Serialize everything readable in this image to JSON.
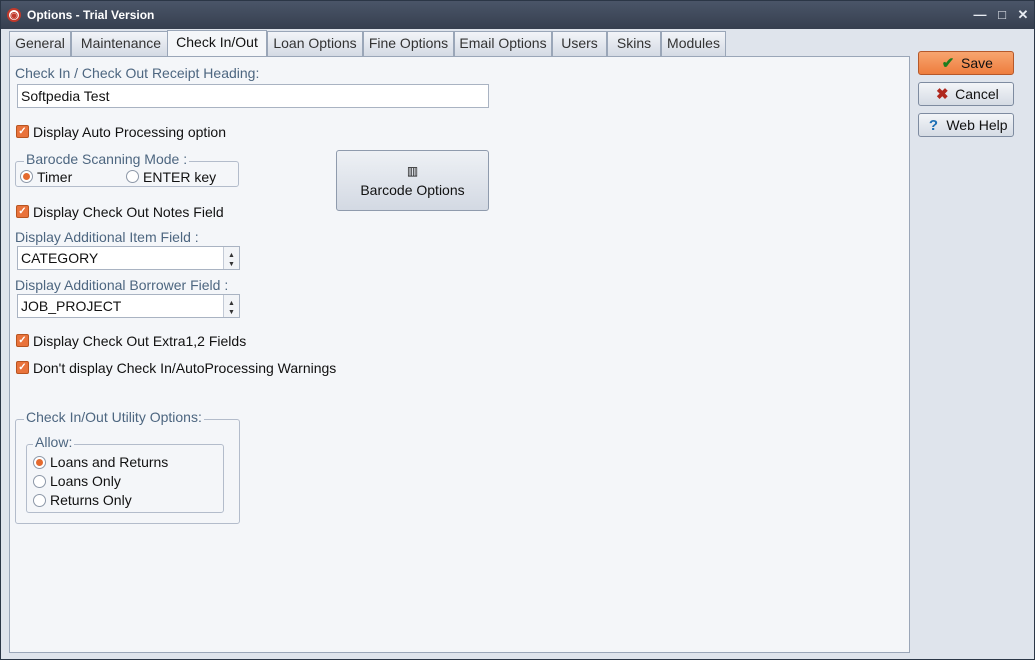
{
  "window": {
    "title": "Options - Trial Version",
    "controls": {
      "minimize": "—",
      "maximize": "□",
      "close": "✕"
    }
  },
  "tabs": [
    {
      "label": "General"
    },
    {
      "label": "Maintenance"
    },
    {
      "label": "Check In/Out",
      "active": true
    },
    {
      "label": "Loan Options"
    },
    {
      "label": "Fine Options"
    },
    {
      "label": "Email Options"
    },
    {
      "label": "Users"
    },
    {
      "label": "Skins"
    },
    {
      "label": "Modules"
    }
  ],
  "content": {
    "receipt_heading_label": "Check In / Check Out Receipt Heading:",
    "receipt_heading_value": "Softpedia Test",
    "auto_processing_label": "Display Auto Processing option",
    "barcode_group_title": "Barocde Scanning Mode :",
    "timer_label": "Timer",
    "enter_key_label": "ENTER key",
    "barcode_options_label": "Barcode Options",
    "checkout_notes_label": "Display Check Out Notes Field",
    "additional_item_label": "Display Additional Item Field :",
    "additional_item_value": "CATEGORY",
    "additional_borrower_label": "Display Additional Borrower Field :",
    "additional_borrower_value": "JOB_PROJECT",
    "extra_fields_label": "Display Check Out Extra1,2 Fields",
    "no_warnings_label": "Don't display Check In/AutoProcessing Warnings",
    "utility_group_title": "Check In/Out Utility Options:",
    "allow_group_title": "Allow:",
    "loans_and_returns_label": "Loans and Returns",
    "loans_only_label": "Loans Only",
    "returns_only_label": "Returns Only"
  },
  "buttons": {
    "save": "Save",
    "cancel": "Cancel",
    "web_help": "Web Help"
  },
  "colors": {
    "accent_orange": "#ee7d3e",
    "label_blue": "#4d6680",
    "titlebar": "#3c4556"
  }
}
